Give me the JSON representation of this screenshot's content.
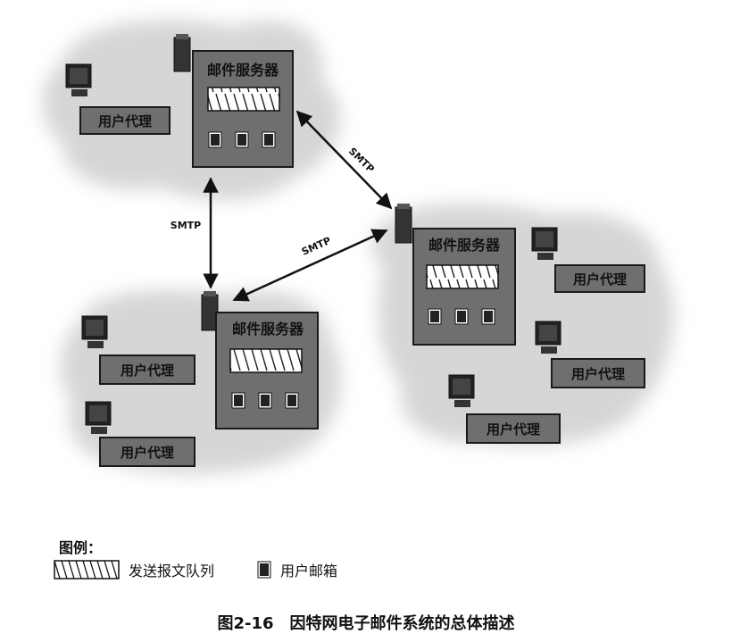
{
  "diagram": {
    "mail_server_label": "邮件服务器",
    "user_agent_label": "用户代理",
    "protocol_label": "SMTP",
    "servers": [
      {
        "id": "server-top",
        "agents": 1
      },
      {
        "id": "server-right",
        "agents": 3
      },
      {
        "id": "server-bottom",
        "agents": 2
      }
    ],
    "links": [
      {
        "from": "server-top",
        "to": "server-right",
        "label": "SMTP"
      },
      {
        "from": "server-top",
        "to": "server-bottom",
        "label": "SMTP"
      },
      {
        "from": "server-bottom",
        "to": "server-right",
        "label": "SMTP"
      }
    ]
  },
  "legend": {
    "title": "图例：",
    "queue_label": "发送报文队列",
    "mailbox_label": "用户邮箱"
  },
  "caption": "图2-16　因特网电子邮件系统的总体描述",
  "colors": {
    "box_fill": "#6f6f6f",
    "box_border": "#1a1a1a",
    "cloud_fill": "#cfcfcf",
    "arrow": "#111111"
  }
}
